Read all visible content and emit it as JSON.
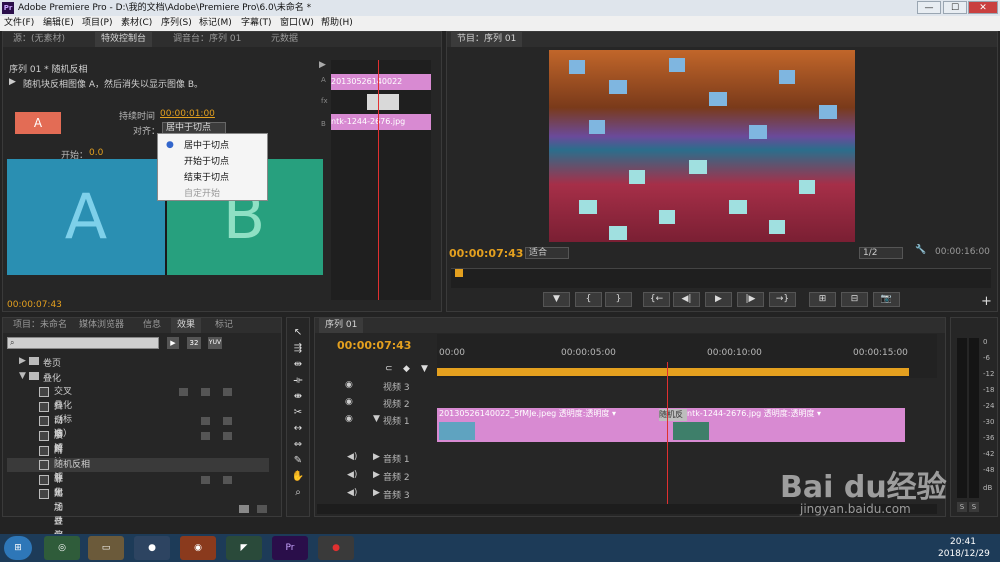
{
  "window": {
    "app_icon": "Pr",
    "title": "Adobe Premiere Pro - D:\\我的文档\\Adobe\\Premiere Pro\\6.0\\未命名 *",
    "controls": [
      "—",
      "☐",
      "✕"
    ]
  },
  "menu": [
    "文件(F)",
    "编辑(E)",
    "项目(P)",
    "素材(C)",
    "序列(S)",
    "标记(M)",
    "字幕(T)",
    "窗口(W)",
    "帮助(H)"
  ],
  "source_panel": {
    "tabs": [
      "源：(无素材)",
      "特效控制台",
      "调音台：序列 01",
      "元数据"
    ],
    "sequence_label": "序列 01 * 随机反相",
    "transition_desc": "随机块反相图像 A，然后消失以显示图像 B。",
    "duration_label": "持续时间",
    "duration_value": "00:00:01:00",
    "align_label": "对齐：",
    "align_value": "居中于切点",
    "start_label": "开始：",
    "start_value": "0.0",
    "letter_a": "A",
    "letter_b": "B",
    "timecode": "00:00:07:43",
    "mini_clip1": "20130526140022",
    "mini_clip2": "ntk-1244-2676.jpg",
    "side_labels": [
      "A",
      "fx",
      "B"
    ]
  },
  "align_dropdown": [
    "居中于切点",
    "开始于切点",
    "结束于切点",
    "自定开始"
  ],
  "program_panel": {
    "tab": "节目：序列 01",
    "timecode": "00:00:07:43",
    "fit": "适合",
    "ratio": "1/2",
    "end_time": "00:00:16:00",
    "transport": [
      "▼",
      "{",
      "}",
      "{←",
      "◀|",
      "▶",
      "|▶",
      "→}",
      "⊞",
      "⊟",
      "📷"
    ]
  },
  "project_panel": {
    "tabs": [
      "项目：未命名",
      "媒体浏览器",
      "信息",
      "效果",
      "标记"
    ],
    "folders": [
      "卷页",
      "叠化"
    ],
    "effects": [
      "交叉叠化（标准）",
      "抖动溶解",
      "白场过渡",
      "胶片溶解",
      "附加叠化",
      "随机反相",
      "非附加叠化",
      "黑场过渡"
    ],
    "toolbar_badges": [
      "32",
      "YUV"
    ]
  },
  "timeline": {
    "tab": "序列 01",
    "timecode": "00:00:07:43",
    "ruler": [
      "00:00",
      "00:00:05:00",
      "00:00:10:00",
      "00:00:15:00"
    ],
    "tracks": [
      "视频 3",
      "视频 2",
      "视频 1",
      "音频 1",
      "音频 2",
      "音频 3"
    ],
    "clip1": "20130526140022_5fMJe.jpeg  透明度:透明度 ▾",
    "clip2": "ntk-1244-2676.jpg  透明度:透明度 ▾",
    "transition": "随机反"
  },
  "meter": {
    "ticks": [
      "0",
      "-6",
      "-12",
      "-18",
      "-24",
      "-30",
      "-36",
      "-42",
      "-48",
      "dB"
    ],
    "solo": [
      "S",
      "S"
    ]
  },
  "tasks": {
    "time": "20:41",
    "date": "2018/12/29"
  },
  "watermark": {
    "brand": "Bai du经验",
    "url": "jingyan.baidu.com"
  }
}
